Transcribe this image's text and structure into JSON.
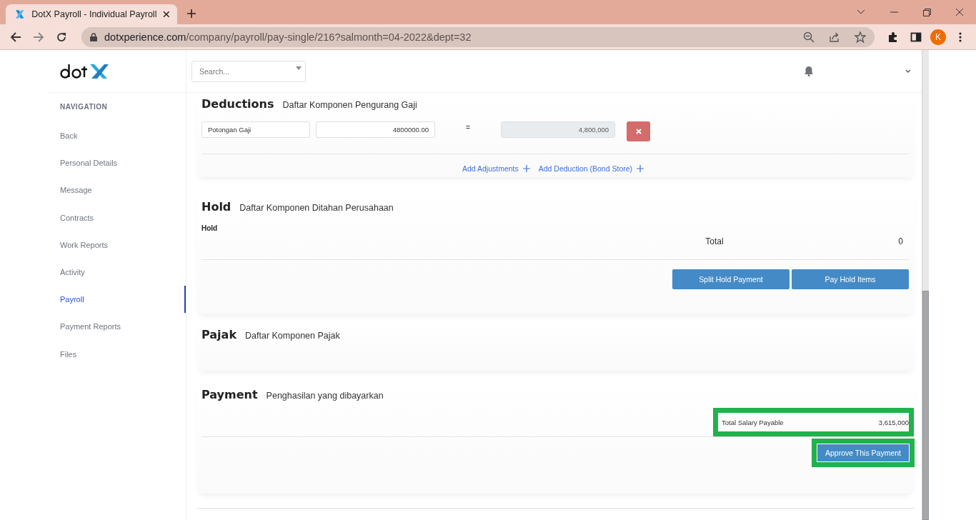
{
  "browser": {
    "tab_title": "DotX Payroll - Individual Payroll",
    "url_host": "dotxperience.com",
    "url_path": "/company/payroll/pay-single/216?salmonth=04-2022&dept=32",
    "profile_initial": "K"
  },
  "header": {
    "search": {
      "placeholder": "Search..."
    }
  },
  "sidebar": {
    "heading": "NAVIGATION",
    "items": [
      {
        "label": "Back",
        "selected": false
      },
      {
        "label": "Personal Details",
        "selected": false
      },
      {
        "label": "Message",
        "selected": false
      },
      {
        "label": "Contracts",
        "selected": false
      },
      {
        "label": "Work Reports",
        "selected": false
      },
      {
        "label": "Activity",
        "selected": false
      },
      {
        "label": "Payroll",
        "selected": true
      },
      {
        "label": "Payment Reports",
        "selected": false
      },
      {
        "label": "Files",
        "selected": false
      }
    ]
  },
  "deductions": {
    "title": "Deductions",
    "subtitle": "Daftar Komponen Pengurang Gaji",
    "rows": [
      {
        "name": "Potongan Gaji",
        "amount": "4800000.00",
        "operator": "=",
        "result": "4,800,000"
      }
    ],
    "links": [
      "Add Adjustments",
      "Add Deduction (Bond Store)"
    ]
  },
  "hold": {
    "title": "Hold",
    "subtitle": "Daftar Komponen Ditahan Perusahaan",
    "label": "Hold",
    "total_label": "Total",
    "total_value": "0",
    "buttons": [
      "Split Hold Payment",
      "Pay Hold Items"
    ]
  },
  "pajak": {
    "title": "Pajak",
    "subtitle": "Daftar Komponen Pajak"
  },
  "payment": {
    "title": "Payment",
    "subtitle": "Penghasilan yang dibayarkan",
    "total_label": "Total Salary Payable",
    "total_value": "3,615,000",
    "total_highlighted": true,
    "button": "Approve This Payment",
    "button_highlighted": true
  }
}
